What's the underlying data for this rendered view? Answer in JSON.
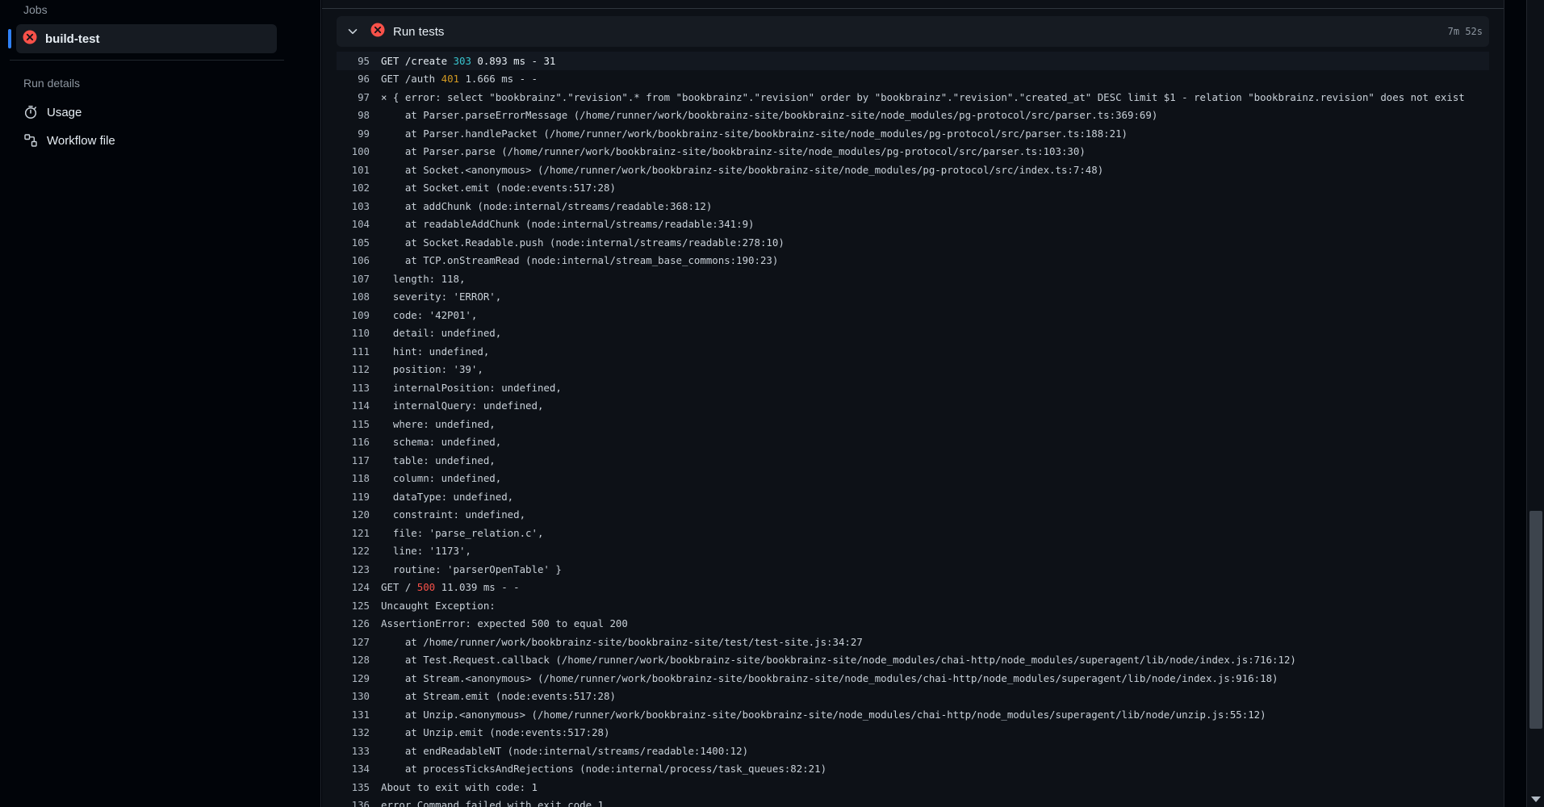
{
  "sidebar": {
    "jobs_heading": "Jobs",
    "job": {
      "label": "build-test",
      "status": "failure"
    },
    "run_details_heading": "Run details",
    "details": [
      {
        "label": "Usage",
        "icon": "stopwatch-icon"
      },
      {
        "label": "Workflow file",
        "icon": "workflow-file-icon"
      }
    ]
  },
  "step": {
    "title": "Run tests",
    "duration": "7m 52s",
    "status": "failure"
  },
  "colors": {
    "failure": "#f85149",
    "accent": "#2f81f7",
    "status_303": "#39c5cf",
    "status_401": "#d29922",
    "status_500": "#f85149"
  },
  "log": [
    {
      "n": "95",
      "segments": [
        {
          "t": "GET /create ",
          "c": "bright"
        },
        {
          "t": "303",
          "c": "cyan"
        },
        {
          "t": " 0.893 ms - 31",
          "c": "bright"
        }
      ],
      "highlight": true
    },
    {
      "n": "96",
      "segments": [
        {
          "t": "GET /auth "
        },
        {
          "t": "401",
          "c": "yellow"
        },
        {
          "t": " 1.666 ms - -"
        }
      ]
    },
    {
      "n": "97",
      "segments": [
        {
          "t": "× { error: select \"bookbrainz\".\"revision\".* from \"bookbrainz\".\"revision\" order by \"bookbrainz\".\"revision\".\"created_at\" DESC limit $1 - relation \"bookbrainz.revision\" does not exist"
        }
      ]
    },
    {
      "n": "98",
      "segments": [
        {
          "t": "    at Parser.parseErrorMessage (/home/runner/work/bookbrainz-site/bookbrainz-site/node_modules/pg-protocol/src/parser.ts:369:69)"
        }
      ]
    },
    {
      "n": "99",
      "segments": [
        {
          "t": "    at Parser.handlePacket (/home/runner/work/bookbrainz-site/bookbrainz-site/node_modules/pg-protocol/src/parser.ts:188:21)"
        }
      ]
    },
    {
      "n": "100",
      "segments": [
        {
          "t": "    at Parser.parse (/home/runner/work/bookbrainz-site/bookbrainz-site/node_modules/pg-protocol/src/parser.ts:103:30)"
        }
      ]
    },
    {
      "n": "101",
      "segments": [
        {
          "t": "    at Socket.<anonymous> (/home/runner/work/bookbrainz-site/bookbrainz-site/node_modules/pg-protocol/src/index.ts:7:48)"
        }
      ]
    },
    {
      "n": "102",
      "segments": [
        {
          "t": "    at Socket.emit (node:events:517:28)"
        }
      ]
    },
    {
      "n": "103",
      "segments": [
        {
          "t": "    at addChunk (node:internal/streams/readable:368:12)"
        }
      ]
    },
    {
      "n": "104",
      "segments": [
        {
          "t": "    at readableAddChunk (node:internal/streams/readable:341:9)"
        }
      ]
    },
    {
      "n": "105",
      "segments": [
        {
          "t": "    at Socket.Readable.push (node:internal/streams/readable:278:10)"
        }
      ]
    },
    {
      "n": "106",
      "segments": [
        {
          "t": "    at TCP.onStreamRead (node:internal/stream_base_commons:190:23)"
        }
      ]
    },
    {
      "n": "107",
      "segments": [
        {
          "t": "  length: 118,"
        }
      ]
    },
    {
      "n": "108",
      "segments": [
        {
          "t": "  severity: 'ERROR',"
        }
      ]
    },
    {
      "n": "109",
      "segments": [
        {
          "t": "  code: '42P01',"
        }
      ]
    },
    {
      "n": "110",
      "segments": [
        {
          "t": "  detail: undefined,"
        }
      ]
    },
    {
      "n": "111",
      "segments": [
        {
          "t": "  hint: undefined,"
        }
      ]
    },
    {
      "n": "112",
      "segments": [
        {
          "t": "  position: '39',"
        }
      ]
    },
    {
      "n": "113",
      "segments": [
        {
          "t": "  internalPosition: undefined,"
        }
      ]
    },
    {
      "n": "114",
      "segments": [
        {
          "t": "  internalQuery: undefined,"
        }
      ]
    },
    {
      "n": "115",
      "segments": [
        {
          "t": "  where: undefined,"
        }
      ]
    },
    {
      "n": "116",
      "segments": [
        {
          "t": "  schema: undefined,"
        }
      ]
    },
    {
      "n": "117",
      "segments": [
        {
          "t": "  table: undefined,"
        }
      ]
    },
    {
      "n": "118",
      "segments": [
        {
          "t": "  column: undefined,"
        }
      ]
    },
    {
      "n": "119",
      "segments": [
        {
          "t": "  dataType: undefined,"
        }
      ]
    },
    {
      "n": "120",
      "segments": [
        {
          "t": "  constraint: undefined,"
        }
      ]
    },
    {
      "n": "121",
      "segments": [
        {
          "t": "  file: 'parse_relation.c',"
        }
      ]
    },
    {
      "n": "122",
      "segments": [
        {
          "t": "  line: '1173',"
        }
      ]
    },
    {
      "n": "123",
      "segments": [
        {
          "t": "  routine: 'parserOpenTable' }"
        }
      ]
    },
    {
      "n": "124",
      "segments": [
        {
          "t": "GET / "
        },
        {
          "t": "500",
          "c": "red"
        },
        {
          "t": " 11.039 ms - -"
        }
      ]
    },
    {
      "n": "125",
      "segments": [
        {
          "t": "Uncaught Exception:"
        }
      ]
    },
    {
      "n": "126",
      "segments": [
        {
          "t": "AssertionError: expected 500 to equal 200"
        }
      ]
    },
    {
      "n": "127",
      "segments": [
        {
          "t": "    at /home/runner/work/bookbrainz-site/bookbrainz-site/test/test-site.js:34:27"
        }
      ]
    },
    {
      "n": "128",
      "segments": [
        {
          "t": "    at Test.Request.callback (/home/runner/work/bookbrainz-site/bookbrainz-site/node_modules/chai-http/node_modules/superagent/lib/node/index.js:716:12)"
        }
      ]
    },
    {
      "n": "129",
      "segments": [
        {
          "t": "    at Stream.<anonymous> (/home/runner/work/bookbrainz-site/bookbrainz-site/node_modules/chai-http/node_modules/superagent/lib/node/index.js:916:18)"
        }
      ]
    },
    {
      "n": "130",
      "segments": [
        {
          "t": "    at Stream.emit (node:events:517:28)"
        }
      ]
    },
    {
      "n": "131",
      "segments": [
        {
          "t": "    at Unzip.<anonymous> (/home/runner/work/bookbrainz-site/bookbrainz-site/node_modules/chai-http/node_modules/superagent/lib/node/unzip.js:55:12)"
        }
      ]
    },
    {
      "n": "132",
      "segments": [
        {
          "t": "    at Unzip.emit (node:events:517:28)"
        }
      ]
    },
    {
      "n": "133",
      "segments": [
        {
          "t": "    at endReadableNT (node:internal/streams/readable:1400:12)"
        }
      ]
    },
    {
      "n": "134",
      "segments": [
        {
          "t": "    at processTicksAndRejections (node:internal/process/task_queues:82:21)"
        }
      ]
    },
    {
      "n": "135",
      "segments": [
        {
          "t": "About to exit with code: 1"
        }
      ]
    },
    {
      "n": "136",
      "segments": [
        {
          "t": "error Command failed with exit code 1."
        }
      ]
    }
  ]
}
